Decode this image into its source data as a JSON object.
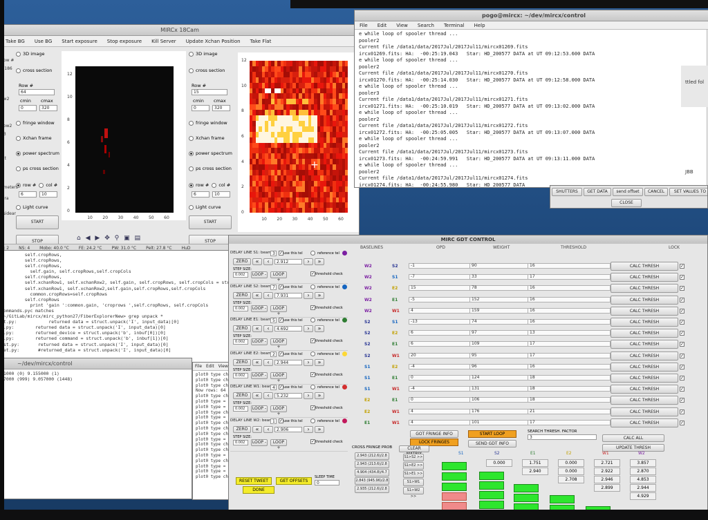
{
  "camwin": {
    "title": "MIRCx 18Cam",
    "menu": [
      "Take BG",
      "Use BG",
      "Start exposure",
      "Stop exposure",
      "Kill Server",
      "Update Xchan Position",
      "Take Flat"
    ],
    "left_panel": {
      "options": [
        "3D image",
        "cross section"
      ],
      "row_label": "Row #",
      "row_value": "64",
      "cmin_label": "cmin",
      "cmax_label": "cmax",
      "cmin_value": "0",
      "cmax_value": "320",
      "modes": [
        "fringe window",
        "Xchan frame",
        "power spectrum",
        "ps cross section"
      ],
      "selected_mode": "power spectrum",
      "row_radio": "row #",
      "col_radio": "col #",
      "range_a": "6",
      "range_b": "10",
      "light_curve": "Light curve",
      "start_label": "START",
      "stop_label": "STOP"
    },
    "right_panel": {
      "options": [
        "3D image",
        "cross section"
      ],
      "row_label": "Row #",
      "row_value": "15",
      "cmin_label": "cmin",
      "cmax_label": "cmax",
      "cmin_value": "0",
      "cmax_value": "320",
      "modes": [
        "fringe window",
        "Xchan frame",
        "power spectrum",
        "ps cross section"
      ],
      "row_radio": "row #",
      "col_radio": "col #",
      "range_a": "6",
      "range_b": "10",
      "light_curve": "Light curve",
      "start_label": "START",
      "stop_label": "STOP"
    },
    "plot1_yticks": [
      "12",
      "10",
      "8",
      "6",
      "4",
      "2",
      "0"
    ],
    "plot1_xticks": [
      "10",
      "20",
      "30",
      "40",
      "50",
      "60"
    ],
    "plot2_yticks": [
      "12",
      "10",
      "8",
      "6",
      "4",
      "2",
      "0"
    ],
    "plot2_xticks": [
      "10",
      "20",
      "30",
      "40",
      "50",
      "60"
    ],
    "left_edge": [
      "Row #",
      "s-186",
      "ow2",
      "0",
      "Row2",
      "23",
      "nit",
      "ameters",
      "iera",
      "xsidear"
    ],
    "status": [
      "L: 2",
      "NS: 4",
      "Mobo: 40.0 °C",
      "FE: 24.2 °C",
      "PW: 31.0 °C",
      "Pelt: 27.8 °C",
      "HuD"
    ]
  },
  "termwin": {
    "title": "pogo@mircx: ~/dev/mircx/control",
    "menu": [
      "File",
      "Edit",
      "View",
      "Search",
      "Terminal",
      "Help"
    ],
    "lines": [
      "e while loop of spooler thread ...",
      "pooler2",
      "Current file /data1/data/2017Jul/2017Jul11/mircx01269.fits",
      "ircx01269.fits: HA:  -00:25:19.043   Star: HD_200577 DATA at UT 09:12:53.600 DATA",
      "e while loop of spooler thread ...",
      "pooler2",
      "Current file /data1/data/2017Jul/2017Jul11/mircx01270.fits",
      "ircx01270.fits: HA:  -00:25:14.030   Star: HD_200577 DATA at UT 09:12:58.000 DATA",
      "e while loop of spooler thread ...",
      "pooler3",
      "Current file /data1/data/2017Jul/2017Jul11/mircx01271.fits",
      "ircx01271.fits: HA:  -00:25:10.019   Star: HD_200577 DATA at UT 09:13:02.000 DATA",
      "e while loop of spooler thread ...",
      "pooler2",
      "Current file /data1/data/2017Jul/2017Jul11/mircx01272.fits",
      "ircx01272.fits: HA:  -00:25:05.005   Star: HD_200577 DATA at UT 09:13:07.000 DATA",
      "e while loop of spooler thread ...",
      "pooler2",
      "Current file /data1/data/2017Jul/2017Jul11/mircx01273.fits",
      "ircx01273.fits: HA:  -00:24:59.991   Star: HD_200577 DATA at UT 09:13:11.000 DATA",
      "e while loop of spooler thread ...",
      "pooler2",
      "Current file /data1/data/2017Jul/2017Jul11/mircx01274.fits",
      "ircx01274.fits: HA:  -00:24:55.980   Star: HD_200577 DATA"
    ]
  },
  "smallwin": {
    "buttons": [
      "SHUTTERS",
      "GET DATA",
      "send offset",
      "CANCEL",
      "SET VALUES TO"
    ],
    "close": "CLOSE"
  },
  "rightmon": {
    "lines": [
      "ttled fol",
      "JBB"
    ]
  },
  "editor": {
    "lines": [
      "        self.cropRows,",
      "        self.cropRows,",
      "        self.cropRows,",
      "          self.gain, self.cropRows,self.cropCols",
      "        self.cropRows,",
      "        self.xchanRow1, self.xchanRow2, self.gain, self.cropRows, self.cropCols = str",
      "        self.xchanRow1, self.xchanRow2,self.gain,self.cropRows,self.cropCols",
      "          common.cropRows=self.cropRows",
      "        self.cropRows",
      "          print 'gain ':common.gain, 'croprows ',self.cropRows, self.cropCols",
      "ommands.pyc matches",
      "~/GitLab/mircx/mirc_python27/FiberExplorerNew> grep unpack *",
      "t.py:            returned data = struct.unpack('I', input_data)[0]",
      ".py:        returned data = struct.unpack('I', input_data)[0]",
      ".py:        returned_device = struct.unpack('b', inbuf[0])[0]",
      ".py:        returned command = struct.unpack('b', inbuf[1])[0]",
      "st.py:       returned data = struct.unpack('I', input_data)[0]",
      "et.py:       #returned_data = struct.unpack('I', input_data)[0]"
    ]
  },
  "term2": {
    "title": "~/dev/mircx/control",
    "lines": [
      "",
      "",
      "",
      "",
      "",
      "",
      "1000 (0) 9.155000 (1)",
      "7000 (999) 9.057000 (1448)"
    ]
  },
  "term3": {
    "menu": [
      "File",
      "Edit",
      "View"
    ],
    "lines": [
      "plot0 type chan",
      "plot0 type chan",
      "plot0 type chan",
      "Now rows: 64",
      "",
      "plot0 type chan",
      "plot0 type = fr",
      "plot0 type = 2D",
      "plot0 type chan",
      "plot0 type = po",
      "plot0 type chan",
      "plot0 type chan",
      "plot0 type chan",
      "plot0 type = po",
      "plot0 type chan",
      "plot0 type chan",
      "plot0 type = cr",
      "plot0 type chan",
      "plot0 type = fr",
      "plot0 type = po",
      "plot0 type chan"
    ]
  },
  "gdt": {
    "title": "MIRC GDT CONTROL",
    "headers": [
      "BASELINES",
      "OPD",
      "WEIGHT",
      "THRESHOLD",
      "LOCK"
    ],
    "delay_lines": [
      {
        "name": "DELAY LINE S1: beam",
        "num": "3",
        "color": "#7b1fa2",
        "value": "2.912"
      },
      {
        "name": "DELAY LINE S2: beam",
        "num": "7",
        "color": "#1565c0",
        "value": "7.931"
      },
      {
        "name": "DELAY LINE E1: beam",
        "num": "5",
        "color": "#2e7d32",
        "value": "4.692"
      },
      {
        "name": "DELAY LINE E2: beam",
        "num": "2",
        "color": "#fdd835",
        "value": "2.944"
      },
      {
        "name": "DELAY LINE W1: beam",
        "num": "4",
        "color": "#d32f2f",
        "value": "5.232"
      },
      {
        "name": "DELAY LINE W2: beam",
        "num": "1",
        "color": "#c2185b",
        "value": "2.906"
      }
    ],
    "line_labels": {
      "use": "use this tel",
      "ref": "reference tel",
      "zero": "ZERO",
      "step": "STEP SIZE:",
      "step_val": "0.002",
      "loop_minus": "LOOP -",
      "loop_plus": "LOOP +",
      "thresh": "threshold check"
    },
    "baselines": [
      [
        "W2",
        "S2"
      ],
      [
        "W2",
        "S1"
      ],
      [
        "W2",
        "E2"
      ],
      [
        "W2",
        "E1"
      ],
      [
        "W2",
        "W1"
      ],
      [
        "S2",
        "S1"
      ],
      [
        "S2",
        "E2"
      ],
      [
        "S2",
        "E1"
      ],
      [
        "S2",
        "W1"
      ],
      [
        "S1",
        "E2"
      ],
      [
        "S1",
        "E1"
      ],
      [
        "S1",
        "W1"
      ],
      [
        "E2",
        "E1"
      ],
      [
        "E2",
        "W1"
      ],
      [
        "E1",
        "W1"
      ]
    ],
    "opd": [
      "-1",
      "-7",
      "15",
      "-5",
      "4",
      "-13",
      "6",
      "6",
      "20",
      "-4",
      "0",
      "-4",
      "0",
      "4",
      "4"
    ],
    "weight": [
      "90",
      "33",
      "78",
      "152",
      "159",
      "74",
      "97",
      "109",
      "95",
      "96",
      "124",
      "131",
      "106",
      "176",
      "101"
    ],
    "threshold": [
      "16",
      "17",
      "16",
      "16",
      "16",
      "16",
      "13",
      "17",
      "17",
      "16",
      "18",
      "18",
      "18",
      "21",
      "17"
    ],
    "calc_label": "CALC THRESH",
    "lock": [
      true,
      true,
      true,
      true,
      true,
      true,
      true,
      true,
      true,
      true,
      true,
      true,
      true,
      true,
      true
    ],
    "mid_buttons": {
      "got_fringe": "GOT FRINGE INFO",
      "start_loop": "START LOOP",
      "search_label": "SEARCH THRESH. FACTOR",
      "search_val": "3",
      "lock_fringes": "LOCK FRINGES",
      "send_gdt": "SEND GDT INFO",
      "calc_all": "CALC ALL",
      "update": "UPDATE THRESH"
    },
    "bottom_left": {
      "reset": "RESET TWEET",
      "get_offsets": "GET OFFSETS",
      "sleep": "SLEEP TIME",
      "sleep_val": "0",
      "done": "DONE"
    },
    "cross_header": "CROSS FRINGE PROB",
    "clear_label": "CLEAR MATRIX",
    "cross_vals": [
      "2.943 (212.6)/2.8",
      "2.943 (213.6)/2.8",
      "4.904 (434.8)/4.7",
      "2.843 (945.96)/2.8",
      "2.935 (212.6)/2.8"
    ],
    "small_btns": [
      "S1>S2 >>",
      "S1>E2 >>",
      "S1>E1 >>",
      "S1>W1 >>",
      "S1>W2 >>"
    ],
    "gridcols": [
      "S1",
      "S2",
      "E1",
      "E2",
      "W1",
      "W2"
    ],
    "gridvals": [
      [
        "0.000",
        "",
        ""
      ],
      [
        "1.751",
        "2.940",
        ""
      ],
      [
        "0.000",
        "0.000",
        "2.708"
      ],
      [
        "2.721",
        "2.922",
        "2.946",
        "2.899"
      ],
      [
        "3.857",
        "2.870",
        "4.853",
        "2.944",
        "4.929"
      ]
    ]
  }
}
